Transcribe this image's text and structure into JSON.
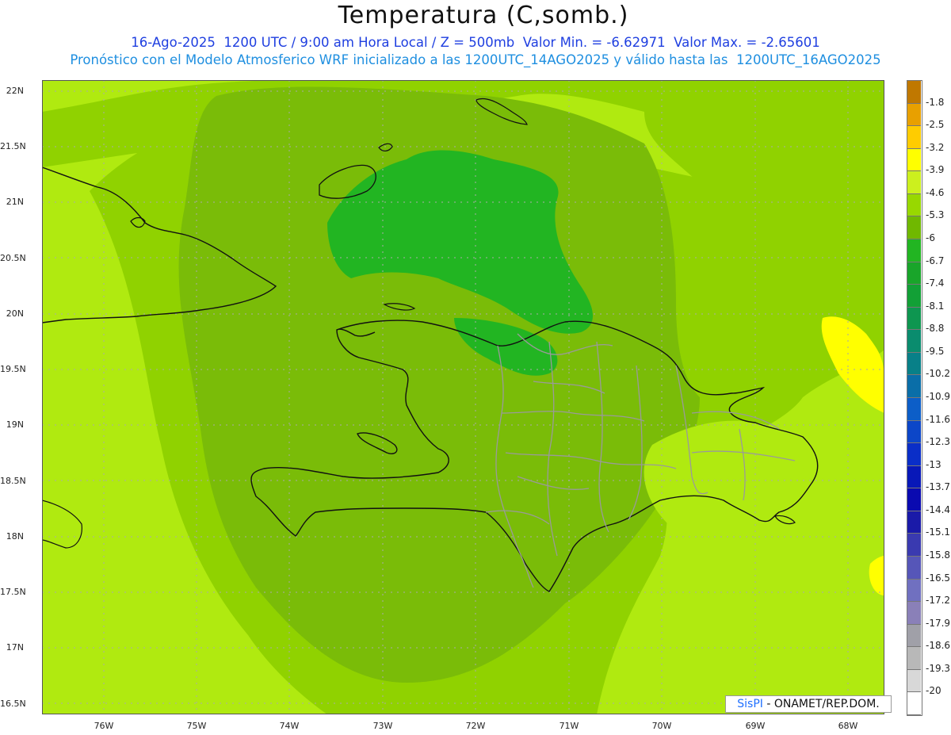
{
  "header": {
    "title": "Temperatura (C,somb.)",
    "line1": "16-Ago-2025  1200 UTC / 9:00 am Hora Local / Z = 500mb  Valor Min. = -6.62971  Valor Max. = -2.65601",
    "line2": "Pronóstico con el Modelo Atmosferico WRF inicializado a las 1200UTC_14AGO2025 y válido hasta las  1200UTC_16AGO2025"
  },
  "axes": {
    "y_labels": [
      "22N",
      "21.5N",
      "21N",
      "20.5N",
      "20N",
      "19.5N",
      "19N",
      "18.5N",
      "18N",
      "17.5N",
      "17N",
      "16.5N"
    ],
    "x_labels": [
      "76W",
      "75W",
      "74W",
      "73W",
      "72W",
      "71W",
      "70W",
      "69W",
      "68W"
    ]
  },
  "colorbar": {
    "labels": [
      "-1.8",
      "-2.5",
      "-3.2",
      "-3.9",
      "-4.6",
      "-5.3",
      "-6",
      "-6.7",
      "-7.4",
      "-8.1",
      "-8.8",
      "-9.5",
      "-10.2",
      "-10.9",
      "-11.6",
      "-12.3",
      "-13",
      "-13.7",
      "-14.4",
      "-15.1",
      "-15.8",
      "-16.5",
      "-17.2",
      "-17.9",
      "-18.6",
      "-19.3",
      "-20"
    ],
    "colors": [
      "#c07800",
      "#e8a000",
      "#ffcc00",
      "#ffff00",
      "#ccf01e",
      "#98d800",
      "#70b800",
      "#22b522",
      "#19a52a",
      "#12a036",
      "#0e9650",
      "#0a8c6e",
      "#088088",
      "#0a6ea8",
      "#0c5ec8",
      "#0c46c8",
      "#0a2ec8",
      "#0818b8",
      "#0a0ab0",
      "#1a1aa8",
      "#3a3ab0",
      "#5656b8",
      "#7070c0",
      "#8a80b8",
      "#a0a0a8",
      "#b8b8b8",
      "#d8d8d8",
      "#ffffff"
    ]
  },
  "credit": {
    "brand": "SisPI",
    "text": " - ONAMET/REP.DOM."
  }
}
